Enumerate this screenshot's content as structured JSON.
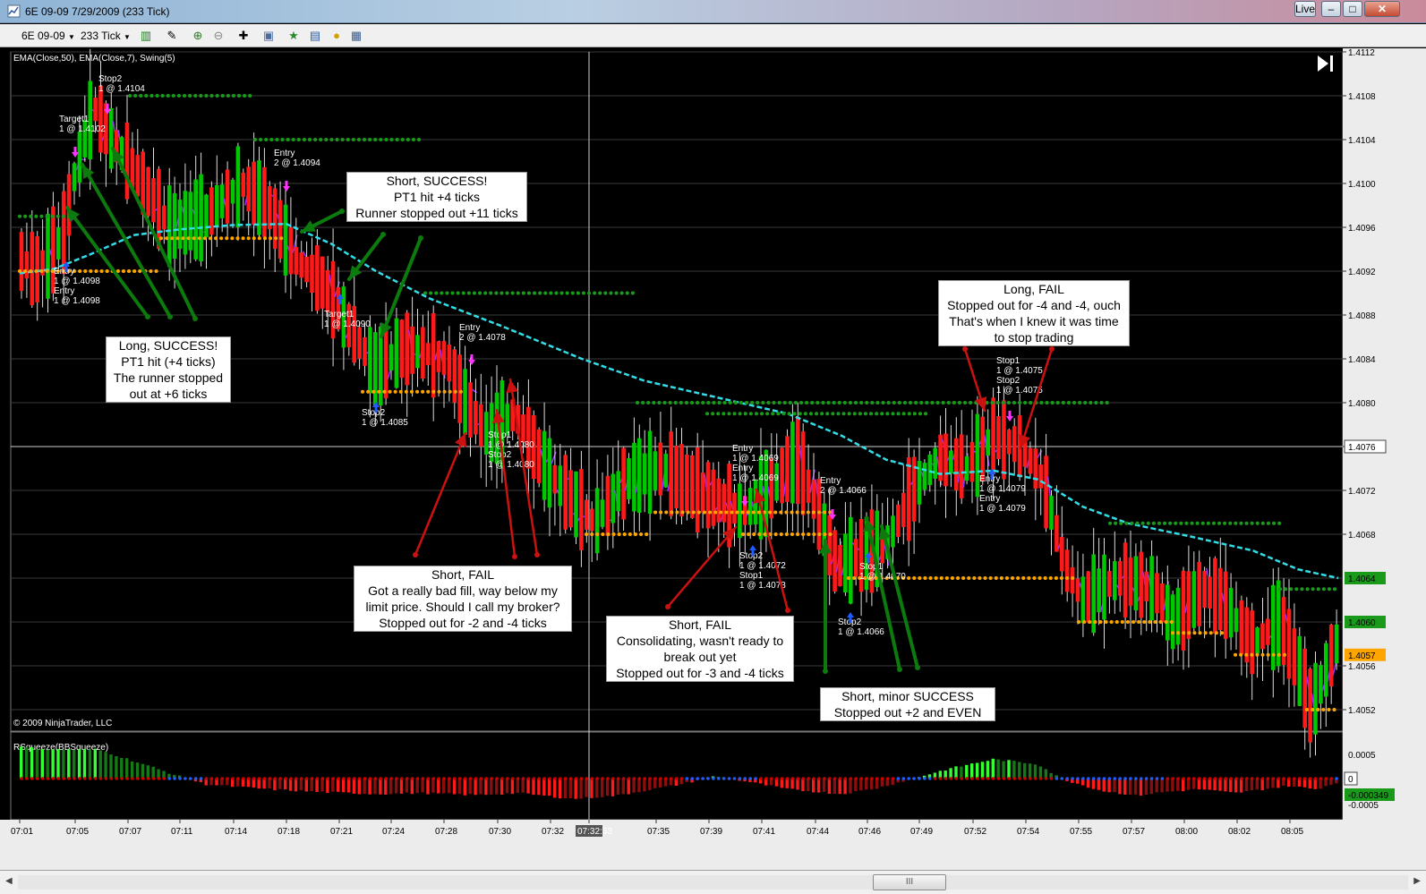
{
  "window": {
    "title": "6E 09-09  7/29/2009 (233 Tick)",
    "buttons": [
      "Live",
      "–",
      "□",
      "✕"
    ]
  },
  "toolbar": {
    "instrument": "6E 09-09",
    "interval": "233 Tick",
    "icons": [
      "bar-type-icon",
      "drawing-tool-icon",
      "zoom-in-icon",
      "zoom-out-icon",
      "crosshair-icon",
      "snapshot-icon",
      "strategy-icon",
      "indicator-icon",
      "coin-icon",
      "data-box-icon"
    ]
  },
  "chart": {
    "indicator_label": "EMA(Close,50), EMA(Close,7), Swing(5)",
    "lower_label": "RSqueeze(BBSqueeze)",
    "copyright": "© 2009 NinjaTrader, LLC",
    "price_ticks": [
      "1.4112",
      "1.4108",
      "1.4104",
      "1.4100",
      "1.4096",
      "1.4092",
      "1.4088",
      "1.4084",
      "1.4080",
      "1.4076",
      "1.4072",
      "1.4068",
      "1.4064",
      "1.4060",
      "1.4057",
      "1.4056",
      "1.4052"
    ],
    "lower_ticks": [
      "0.0005",
      "0",
      "-0.000349",
      "-0.0005"
    ],
    "crosshair_price": "1.4076",
    "time_ticks": [
      "07:01",
      "07:05",
      "07:07",
      "07:11",
      "07:14",
      "07:18",
      "07:21",
      "07:24",
      "07:28",
      "07:30",
      "07:32",
      "07:32:33",
      "07:35",
      "07:39",
      "07:41",
      "07:44",
      "07:46",
      "07:49",
      "07:52",
      "07:54",
      "07:55",
      "07:57",
      "08:00",
      "08:02",
      "08:05"
    ],
    "trade_labels": [
      [
        "Stop2",
        "1 @ 1.4104"
      ],
      [
        "Target1",
        "1 @ 1.4102"
      ],
      [
        "Entry",
        "1 @ 1.4098",
        "Entry",
        "1 @ 1.4098"
      ],
      [
        "Entry",
        "2 @ 1.4094"
      ],
      [
        "Target1",
        "1 @ 1.4090"
      ],
      [
        "Entry",
        "2 @ 1.4078"
      ],
      [
        "Stop2",
        "1 @ 1.4085"
      ],
      [
        "Stop1",
        "1 @ 1.4080",
        "Stop2",
        "1 @ 1.4080"
      ],
      [
        "Entry",
        "1 @ 1.4069",
        "Entry",
        "1 @ 1.4069"
      ],
      [
        "Entry",
        "2 @ 1.4066"
      ],
      [
        "Stop2",
        "1 @ 1.4072",
        "Stop1",
        "1 @ 1.4073"
      ],
      [
        "Stop1",
        "1 @ 1.4070"
      ],
      [
        "Stop2",
        "1 @ 1.4066"
      ],
      [
        "Stop1",
        "1 @ 1.4075",
        "Stop2",
        "1 @ 1.4075"
      ],
      [
        "Entry",
        "1 @ 1.4079",
        "Entry",
        "1 @ 1.4079"
      ]
    ]
  },
  "annotations": [
    [
      "Short, SUCCESS!",
      "PT1 hit +4 ticks",
      "Runner stopped out +11 ticks"
    ],
    [
      "Long, SUCCESS!",
      "PT1 hit (+4 ticks)",
      "The runner stopped",
      "out at +6 ticks"
    ],
    [
      "Long, FAIL",
      "Stopped out for -4 and -4, ouch",
      "That's when I knew it was time",
      "to stop trading"
    ],
    [
      "Short, FAIL",
      "Got a really bad fill, way below my",
      "limit price.  Should I call my broker?",
      "Stopped out for -2 and -4 ticks"
    ],
    [
      "Short, FAIL",
      "Consolidating, wasn't ready to",
      "break out yet",
      "Stopped out for -3 and -4 ticks"
    ],
    [
      "Short, minor SUCCESS",
      "Stopped out +2 and EVEN"
    ]
  ],
  "colors": {
    "up_bar": "#00c800",
    "down_bar": "#ff1a1a",
    "ema50": "#33dde8",
    "ema7": "#9b2fff",
    "swing_high": "#1a9a1a",
    "swing_low": "#ffa500",
    "green_arrow": "#0d7a0d",
    "red_arrow": "#cc1111"
  },
  "scrollbar": {
    "thumb": "III"
  }
}
